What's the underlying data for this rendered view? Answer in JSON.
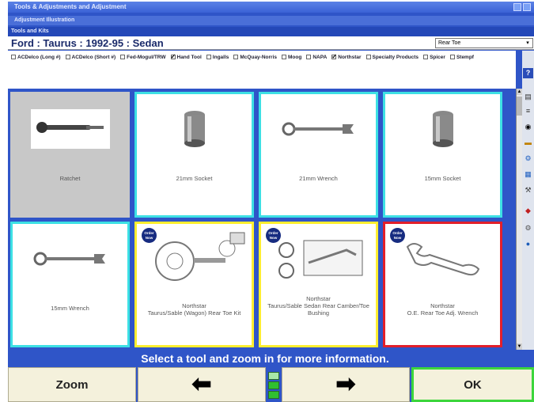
{
  "window": {
    "title": "Tools & Adjustments and Adjustment",
    "subtitle": "Adjustment Illustration",
    "section": "Tools and Kits"
  },
  "vehicle": {
    "title": "Ford : Taurus : 1992-95 : Sedan",
    "dropdown_value": "Rear Toe"
  },
  "filters": [
    {
      "label": "ACDelco (Long #)",
      "checked": false
    },
    {
      "label": "ACDelco (Short #)",
      "checked": false
    },
    {
      "label": "Fed-Mogul/TRW",
      "checked": false
    },
    {
      "label": "Hand Tool",
      "checked": true
    },
    {
      "label": "Ingalls",
      "checked": false
    },
    {
      "label": "McQuay-Norris",
      "checked": false
    },
    {
      "label": "Moog",
      "checked": false
    },
    {
      "label": "NAPA",
      "checked": false
    },
    {
      "label": "Northstar",
      "checked": true
    },
    {
      "label": "Specialty Products",
      "checked": false
    },
    {
      "label": "Spicer",
      "checked": false
    },
    {
      "label": "Stempf",
      "checked": false
    }
  ],
  "tools": [
    {
      "label": "Ratchet",
      "icon": "ratchet-icon",
      "state": "selected"
    },
    {
      "label": "21mm Socket",
      "icon": "socket-icon",
      "state": "normal"
    },
    {
      "label": "21mm Wrench",
      "icon": "wrench-icon",
      "state": "normal"
    },
    {
      "label": "15mm Socket",
      "icon": "socket-icon",
      "state": "normal"
    },
    {
      "label": "15mm Wrench",
      "icon": "wrench-icon",
      "state": "normal"
    },
    {
      "label": "Northstar\nTaurus/Sable (Wagon) Rear Toe Kit",
      "icon": "toe-kit-icon",
      "state": "yellow",
      "badge": "Order Now"
    },
    {
      "label": "Northstar\nTaurus/Sable Sedan Rear Camber/Toe Bushing",
      "icon": "bushing-icon",
      "state": "yellow",
      "badge": "Order Now"
    },
    {
      "label": "Northstar\nO.E. Rear Toe Adj. Wrench",
      "icon": "adj-wrench-icon",
      "state": "red",
      "badge": "Order Now"
    }
  ],
  "status": "Select a tool and zoom in for more information.",
  "buttons": {
    "zoom": "Zoom",
    "prev": "⬅",
    "next": "➡",
    "ok": "OK"
  },
  "colors": {
    "accent": "#2f55c8",
    "tile_border": "#3de0e4",
    "order_border": "#ffee30",
    "selected_border": "#e21f2a",
    "ok_border": "#3cd63c"
  }
}
